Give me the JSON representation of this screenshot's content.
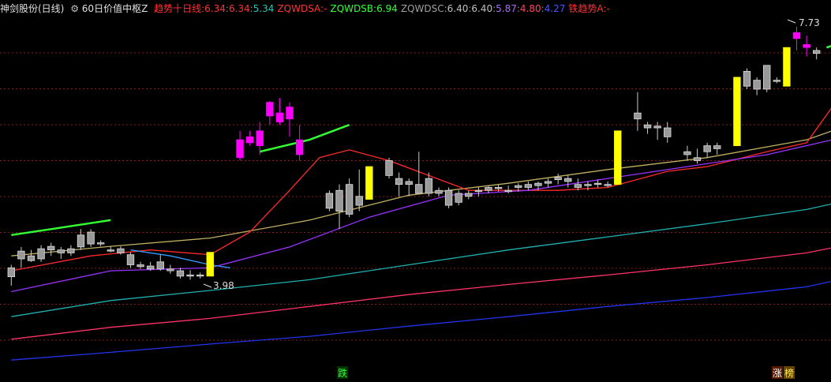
{
  "legend": {
    "stock_name": "神剑股份(日线)",
    "indicator_name": "60日价值中枢Z",
    "items": [
      {
        "label": "趋势十日线:",
        "values": [
          "6.34",
          "6.34",
          "5.34"
        ],
        "colors": [
          "#ff3333",
          "#ff3333",
          "#2ec4b6"
        ]
      },
      {
        "label": "ZQWDSA:",
        "values": [
          "-"
        ],
        "colors": [
          "#ff3333"
        ]
      },
      {
        "label": "ZQWDSB:",
        "values": [
          "6.94"
        ],
        "colors": [
          "#33ff33"
        ]
      },
      {
        "label": "ZQWDSC:",
        "values": [
          "6.40",
          "6.40",
          "5.87",
          "4.80",
          "4.27"
        ],
        "colors": [
          "#c0c0c0",
          "#c0c0c0",
          "#b266ff",
          "#ff4466",
          "#4455ff"
        ]
      },
      {
        "label": "铁趋势A:",
        "values": [
          "-"
        ],
        "colors": [
          "#ff3333"
        ]
      }
    ],
    "label_colors": [
      "#ff3333",
      "#ff3333",
      "#33ff33",
      "#a0a0a0",
      "#ff3333"
    ]
  },
  "annotations": {
    "high_label": "7.73",
    "low_label": "3.98",
    "signal_fall": "跌",
    "signal_rise": "涨",
    "signal_rank": "榜"
  },
  "colors": {
    "background": "#000000",
    "grid": "#8a1d1d",
    "up_fill": "#ff00ff",
    "yellow_bar": "#ffff00",
    "down_fill": "#999999",
    "trend_green": "#33ff33",
    "ma_red": "#ff2a2a",
    "ma_olive": "#c0b060",
    "ma_purple": "#9933ff",
    "ma_teal": "#20b0b0",
    "ma_pink": "#ff3366",
    "ma_blue": "#2233ee",
    "ma_blue_short": "#3399ff"
  },
  "chart_data": {
    "type": "candlestick",
    "title": "",
    "ylim": [
      2.4,
      8.1
    ],
    "candles": [
      [
        3.85,
        4.05,
        3.7,
        4.0,
        "g"
      ],
      [
        4.15,
        4.35,
        4.0,
        4.28,
        "g"
      ],
      [
        4.2,
        4.3,
        4.1,
        4.12,
        "g"
      ],
      [
        4.15,
        4.38,
        4.1,
        4.32,
        "g"
      ],
      [
        4.3,
        4.42,
        4.2,
        4.36,
        "g"
      ],
      [
        4.25,
        4.35,
        4.15,
        4.3,
        "g"
      ],
      [
        4.32,
        4.38,
        4.2,
        4.25,
        "g"
      ],
      [
        4.35,
        4.65,
        4.3,
        4.55,
        "g"
      ],
      [
        4.6,
        4.65,
        4.35,
        4.4,
        "g"
      ],
      [
        4.42,
        4.46,
        4.36,
        4.4,
        "g"
      ],
      [
        4.3,
        4.36,
        4.26,
        4.28,
        "g"
      ],
      [
        4.32,
        4.36,
        4.22,
        4.25,
        "g"
      ],
      [
        4.22,
        4.26,
        4.0,
        4.05,
        "g"
      ],
      [
        4.05,
        4.1,
        3.98,
        4.02,
        "g"
      ],
      [
        4.03,
        4.1,
        3.95,
        3.98,
        "g"
      ],
      [
        4.1,
        4.22,
        3.95,
        3.98,
        "g"
      ],
      [
        3.95,
        4.05,
        3.9,
        3.98,
        "g"
      ],
      [
        3.95,
        4.0,
        3.82,
        3.86,
        "g"
      ],
      [
        3.88,
        3.96,
        3.8,
        3.88,
        "g"
      ],
      [
        3.86,
        3.92,
        3.82,
        3.88,
        "g"
      ],
      [
        3.86,
        4.26,
        3.86,
        4.26,
        "y"
      ],
      null,
      null,
      [
        5.85,
        6.3,
        5.8,
        6.15,
        "m"
      ],
      [
        6.2,
        6.3,
        6.05,
        6.1,
        "m"
      ],
      [
        6.05,
        6.45,
        5.9,
        6.3,
        "m"
      ],
      [
        6.55,
        6.8,
        6.4,
        6.78,
        "m"
      ],
      [
        6.6,
        6.85,
        6.4,
        6.45,
        "m"
      ],
      [
        6.5,
        6.78,
        6.2,
        6.7,
        "m"
      ],
      [
        6.15,
        6.4,
        5.8,
        5.9,
        "m"
      ],
      null,
      null,
      [
        5.0,
        5.3,
        4.95,
        5.25,
        "g"
      ],
      [
        5.3,
        5.4,
        4.65,
        4.95,
        "g"
      ],
      [
        4.9,
        5.5,
        4.85,
        5.4,
        "g"
      ],
      [
        5.2,
        5.65,
        4.95,
        5.05,
        "g"
      ],
      [
        5.15,
        5.7,
        5.15,
        5.7,
        "y"
      ],
      null,
      [
        5.8,
        5.85,
        5.5,
        5.55,
        "g"
      ],
      [
        5.5,
        5.6,
        5.2,
        5.4,
        "g"
      ],
      [
        5.4,
        5.5,
        5.2,
        5.45,
        "g"
      ],
      [
        5.4,
        5.95,
        5.3,
        5.25,
        "g"
      ],
      [
        5.5,
        5.6,
        5.2,
        5.25,
        "g"
      ],
      [
        5.25,
        5.35,
        5.2,
        5.3,
        "g"
      ],
      [
        5.3,
        5.35,
        5.0,
        5.05,
        "g"
      ],
      [
        5.25,
        5.3,
        5.05,
        5.1,
        "g"
      ],
      [
        5.2,
        5.3,
        5.15,
        5.25,
        "g"
      ],
      [
        5.28,
        5.35,
        5.2,
        5.3,
        "g"
      ],
      [
        5.3,
        5.38,
        5.25,
        5.35,
        "g"
      ],
      [
        5.35,
        5.4,
        5.28,
        5.33,
        "g"
      ],
      [
        5.3,
        5.38,
        5.25,
        5.3,
        "g"
      ],
      [
        5.35,
        5.42,
        5.28,
        5.38,
        "g"
      ],
      [
        5.35,
        5.45,
        5.3,
        5.4,
        "g"
      ],
      [
        5.38,
        5.45,
        5.3,
        5.42,
        "g"
      ],
      [
        5.42,
        5.5,
        5.35,
        5.45,
        "g"
      ],
      [
        5.48,
        5.58,
        5.4,
        5.52,
        "g"
      ],
      [
        5.45,
        5.55,
        5.35,
        5.5,
        "g"
      ],
      [
        5.4,
        5.5,
        5.3,
        5.35,
        "g"
      ],
      [
        5.38,
        5.45,
        5.3,
        5.4,
        "g"
      ],
      [
        5.4,
        5.48,
        5.35,
        5.42,
        "g"
      ],
      [
        5.4,
        5.45,
        5.35,
        5.38,
        "g"
      ],
      [
        5.4,
        6.3,
        5.4,
        6.3,
        "y"
      ],
      null,
      [
        6.5,
        6.95,
        6.3,
        6.6,
        "g"
      ],
      [
        6.35,
        6.45,
        6.25,
        6.4,
        "g"
      ],
      [
        6.38,
        6.45,
        6.15,
        6.35,
        "g"
      ],
      [
        6.35,
        6.45,
        6.1,
        6.2,
        "g"
      ],
      null,
      [
        5.9,
        6.05,
        5.8,
        5.95,
        "g"
      ],
      [
        5.85,
        6.0,
        5.75,
        5.8,
        "g"
      ],
      [
        5.95,
        6.1,
        5.85,
        6.05,
        "g"
      ],
      [
        6.0,
        6.1,
        5.9,
        6.05,
        "g"
      ],
      null,
      [
        6.05,
        7.2,
        6.05,
        7.2,
        "y"
      ],
      [
        7.05,
        7.35,
        7.0,
        7.3,
        "g"
      ],
      [
        7.15,
        7.2,
        6.9,
        7.0,
        "g"
      ],
      [
        7.0,
        7.4,
        6.95,
        7.4,
        "g"
      ],
      [
        7.15,
        7.2,
        7.1,
        7.15,
        "g"
      ],
      [
        7.05,
        7.7,
        7.05,
        7.7,
        "y"
      ],
      [
        7.85,
        8.05,
        7.65,
        7.95,
        "m"
      ],
      [
        7.7,
        7.9,
        7.55,
        7.75,
        "m"
      ],
      [
        7.6,
        7.7,
        7.5,
        7.65,
        "g"
      ]
    ],
    "series": [
      {
        "key": "ma_olive",
        "points": [
          [
            0,
            4.2
          ],
          [
            10,
            4.36
          ],
          [
            20,
            4.5
          ],
          [
            30,
            4.8
          ],
          [
            40,
            5.22
          ],
          [
            50,
            5.42
          ],
          [
            60,
            5.65
          ],
          [
            70,
            5.85
          ],
          [
            80,
            6.15
          ],
          [
            86,
            6.5
          ]
        ]
      },
      {
        "key": "ma_red",
        "points": [
          [
            0,
            3.95
          ],
          [
            8,
            4.2
          ],
          [
            14,
            4.3
          ],
          [
            20,
            4.22
          ],
          [
            24,
            4.6
          ],
          [
            28,
            5.3
          ],
          [
            31,
            5.85
          ],
          [
            34,
            5.98
          ],
          [
            38,
            5.8
          ],
          [
            42,
            5.55
          ],
          [
            46,
            5.3
          ],
          [
            55,
            5.3
          ],
          [
            60,
            5.35
          ],
          [
            66,
            5.62
          ],
          [
            70,
            5.7
          ],
          [
            76,
            5.95
          ],
          [
            80,
            6.1
          ],
          [
            83,
            6.8
          ],
          [
            86,
            7.25
          ]
        ]
      },
      {
        "key": "ma_purple",
        "points": [
          [
            0,
            3.6
          ],
          [
            10,
            3.95
          ],
          [
            20,
            4.0
          ],
          [
            28,
            4.35
          ],
          [
            36,
            4.85
          ],
          [
            44,
            5.22
          ],
          [
            52,
            5.3
          ],
          [
            60,
            5.5
          ],
          [
            68,
            5.7
          ],
          [
            76,
            5.9
          ],
          [
            86,
            6.28
          ]
        ]
      },
      {
        "key": "ma_teal",
        "points": [
          [
            0,
            3.18
          ],
          [
            10,
            3.45
          ],
          [
            20,
            3.62
          ],
          [
            30,
            3.8
          ],
          [
            40,
            4.05
          ],
          [
            50,
            4.3
          ],
          [
            60,
            4.52
          ],
          [
            70,
            4.74
          ],
          [
            80,
            4.98
          ],
          [
            86,
            5.2
          ]
        ]
      },
      {
        "key": "ma_pink",
        "points": [
          [
            0,
            2.8
          ],
          [
            10,
            3.0
          ],
          [
            20,
            3.15
          ],
          [
            30,
            3.35
          ],
          [
            40,
            3.55
          ],
          [
            50,
            3.72
          ],
          [
            60,
            3.88
          ],
          [
            70,
            4.05
          ],
          [
            80,
            4.25
          ],
          [
            86,
            4.45
          ]
        ]
      },
      {
        "key": "ma_blue",
        "points": [
          [
            0,
            2.45
          ],
          [
            10,
            2.58
          ],
          [
            20,
            2.72
          ],
          [
            30,
            2.85
          ],
          [
            40,
            3.02
          ],
          [
            50,
            3.18
          ],
          [
            60,
            3.35
          ],
          [
            70,
            3.5
          ],
          [
            80,
            3.68
          ],
          [
            86,
            3.9
          ]
        ]
      },
      {
        "key": "ma_blue_short",
        "points": [
          [
            12,
            4.3
          ],
          [
            16,
            4.2
          ],
          [
            20,
            4.05
          ],
          [
            22,
            4.0
          ]
        ]
      },
      {
        "key": "trend_green",
        "points": [
          [
            0,
            4.55
          ],
          [
            4,
            4.65
          ],
          [
            8,
            4.75
          ],
          [
            10,
            4.8
          ]
        ]
      },
      {
        "key": "trend_green",
        "points": [
          [
            25,
            5.95
          ],
          [
            30,
            6.15
          ],
          [
            34,
            6.4
          ]
        ]
      },
      {
        "key": "trend_green",
        "points": [
          [
            82,
            7.7
          ],
          [
            86,
            7.9
          ]
        ]
      }
    ]
  }
}
